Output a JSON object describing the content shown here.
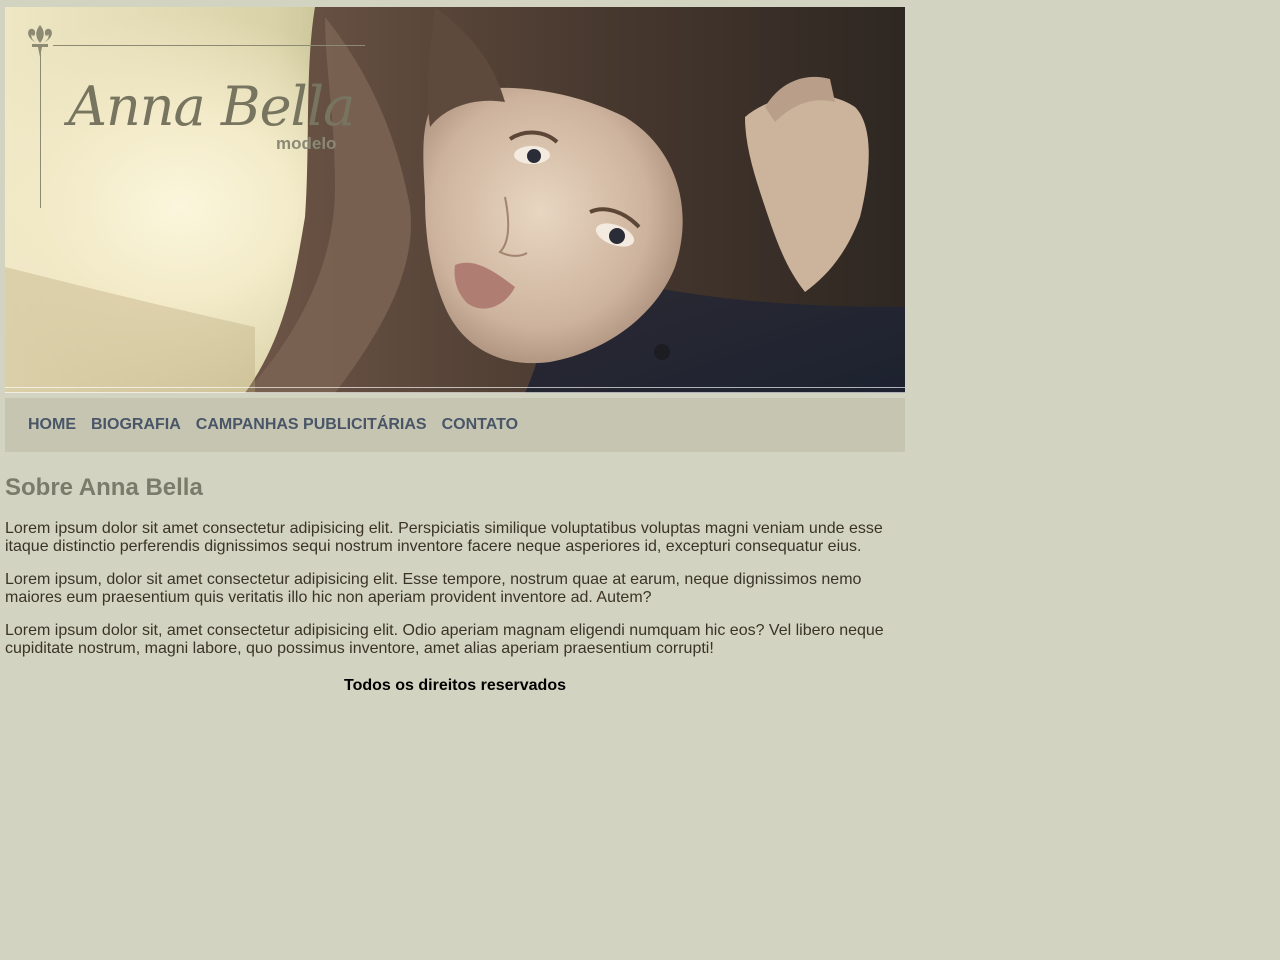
{
  "header": {
    "logo": {
      "name": "Anna Bella",
      "subtitle": "modelo",
      "icon": "fleur-de-lis-icon"
    },
    "banner_image": "portrait-photo"
  },
  "nav": {
    "items": [
      {
        "label": "HOME"
      },
      {
        "label": "BIOGRAFIA"
      },
      {
        "label": "CAMPANHAS PUBLICITÁRIAS"
      },
      {
        "label": "CONTATO"
      }
    ]
  },
  "main": {
    "title": "Sobre Anna Bella",
    "paragraphs": [
      "Lorem ipsum dolor sit amet consectetur adipisicing elit. Perspiciatis similique voluptatibus voluptas magni veniam unde esse itaque distinctio perferendis dignissimos sequi nostrum inventore facere neque asperiores id, excepturi consequatur eius.",
      "Lorem ipsum, dolor sit amet consectetur adipisicing elit. Esse tempore, nostrum quae at earum, neque dignissimos nemo maiores eum praesentium quis veritatis illo hic non aperiam provident inventore ad. Autem?",
      "Lorem ipsum dolor sit, amet consectetur adipisicing elit. Odio aperiam magnam eligendi numquam hic eos? Vel libero neque cupiditate nostrum, magni labore, quo possimus inventore, amet alias aperiam praesentium corrupti!"
    ]
  },
  "footer": {
    "text": "Todos os direitos reservados"
  },
  "colors": {
    "page_background": "#d2d3c0",
    "nav_background": "#c5c5b1",
    "nav_link": "#4a5668",
    "heading": "#7a7b6b",
    "body_text": "#3b3327"
  }
}
